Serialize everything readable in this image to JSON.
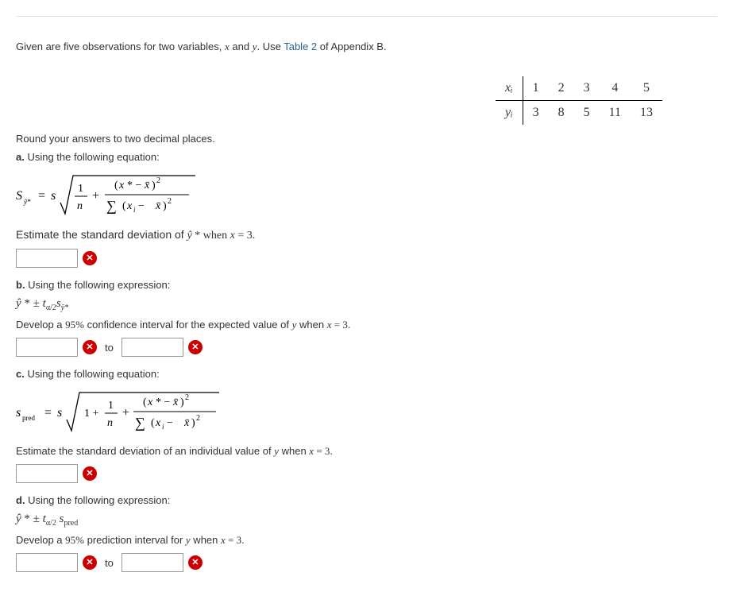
{
  "intro": {
    "prefix": "Given are five observations for two variables, ",
    "vars": "x and y",
    "mid": ". Use ",
    "link": "Table 2",
    "suffix": " of Appendix B."
  },
  "table": {
    "xi_label": "xᵢ",
    "yi_label": "yᵢ",
    "x": [
      "1",
      "2",
      "3",
      "4",
      "5"
    ],
    "y": [
      "3",
      "8",
      "5",
      "11",
      "13"
    ]
  },
  "round_note": "Round your answers to two decimal places.",
  "a": {
    "heading": "a.",
    "heading_text": " Using the following equation:",
    "estimate": "Estimate the standard deviation of ŷ * when x = 3."
  },
  "b": {
    "heading": "b.",
    "heading_text": " Using the following expression:",
    "expr": "ŷ * ± tα/2 sŷ*",
    "develop": "Develop a 95% confidence interval for the expected value of y when x = 3.",
    "to": "to"
  },
  "c": {
    "heading": "c.",
    "heading_text": " Using the following equation:",
    "estimate": "Estimate the standard deviation of an individual value of y when x = 3."
  },
  "d": {
    "heading": "d.",
    "heading_text": " Using the following expression:",
    "expr": "ŷ * ± tα/2 spred",
    "develop": "Develop a 95% prediction interval for y when x = 3.",
    "to": "to"
  },
  "chart_data": {
    "type": "table",
    "rows": [
      {
        "label": "xᵢ",
        "values": [
          1,
          2,
          3,
          4,
          5
        ]
      },
      {
        "label": "yᵢ",
        "values": [
          3,
          8,
          5,
          11,
          13
        ]
      }
    ]
  }
}
